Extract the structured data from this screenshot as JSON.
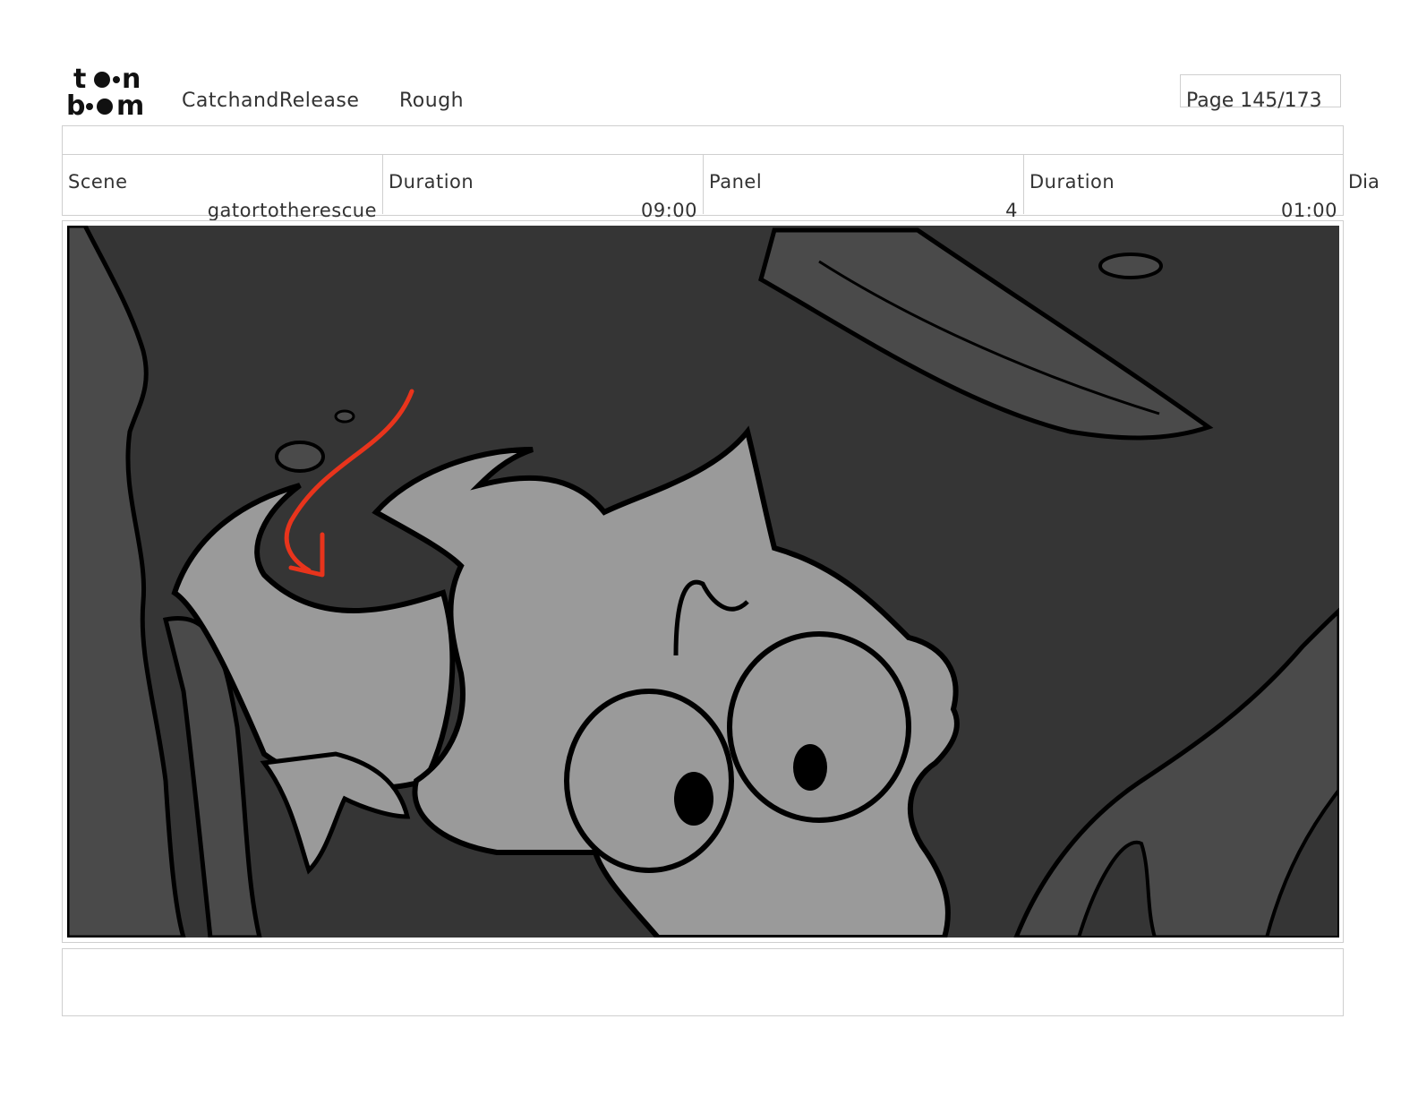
{
  "header": {
    "logo_icon": "toonboom-logo-icon",
    "project": "CatchandRelease",
    "stage": "Rough",
    "page": "Page 145/173"
  },
  "info": {
    "scene_label": "Scene",
    "scene_value": "gatortotherescue",
    "scene_duration_label": "Duration",
    "scene_duration_value": "09:00",
    "panel_label": "Panel",
    "panel_value": "4",
    "panel_duration_label": "Duration",
    "panel_duration_value": "01:00",
    "dialogue_label": "Dia"
  },
  "panel": {
    "content": "storyboard-drawing",
    "colors": {
      "background": "#353535",
      "foliage": "#4a4a4a",
      "character": "#9a9a9a",
      "line": "#000000",
      "arrow": "#e8341c"
    }
  },
  "notes": {
    "text": ""
  }
}
